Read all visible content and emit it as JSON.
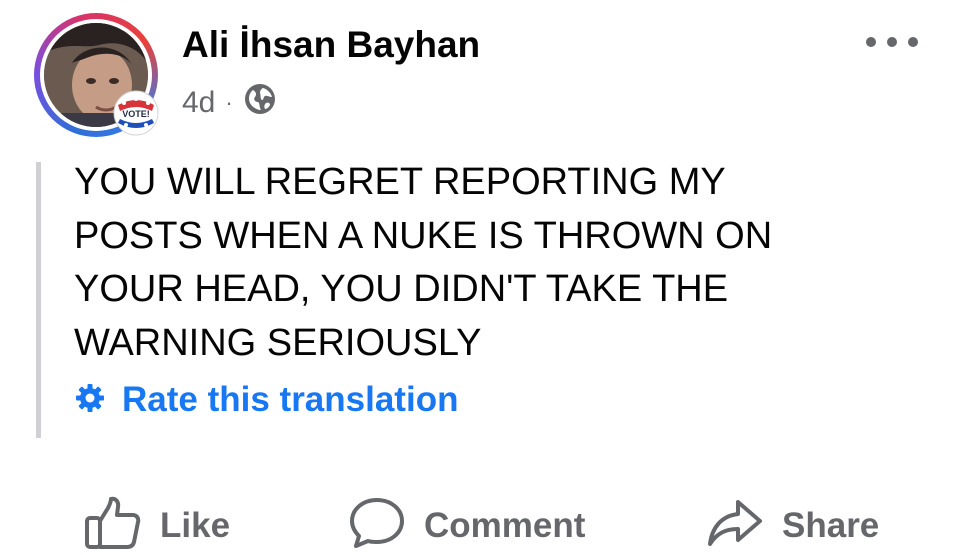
{
  "post": {
    "author_name": "Ali İhsan Bayhan",
    "timestamp": "4d",
    "separator": "·",
    "privacy_icon": "globe-icon",
    "avatar_badge_text": "VOTE!",
    "more_icon": "more-options-icon",
    "text_lines": [
      "YOU WILL REGRET REPORTING MY",
      "POSTS WHEN A NUKE IS THROWN ON",
      "YOUR HEAD, YOU DIDN'T TAKE THE",
      "WARNING SERIOUSLY"
    ],
    "translation_link": "Rate this translation",
    "translation_icon": "gear-icon"
  },
  "actions": {
    "like": "Like",
    "comment": "Comment",
    "share": "Share"
  },
  "colors": {
    "link": "#1877f2",
    "secondary_text": "#65676b",
    "primary_text": "#050505"
  }
}
